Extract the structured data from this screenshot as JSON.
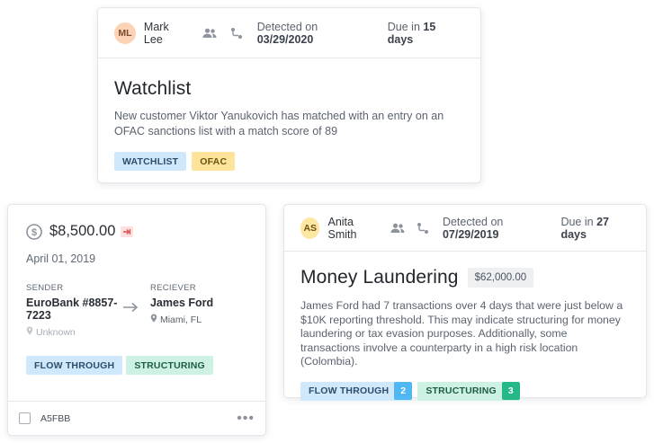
{
  "watchlist_card": {
    "avatar_initials": "ML",
    "owner": "Mark Lee",
    "detected_prefix": "Detected on",
    "detected_date": "03/29/2020",
    "due_prefix": "Due in",
    "due_value": "15 days",
    "title": "Watchlist",
    "description": "New customer Viktor Yanukovich has matched with an entry on an OFAC sanctions list with a match score of 89",
    "tags": [
      "WATCHLIST",
      "OFAC"
    ]
  },
  "transaction_card": {
    "amount": "$8,500.00",
    "date": "April 01, 2019",
    "sender_label": "SENDER",
    "sender_name": "EuroBank #8857-7223",
    "sender_location": "Unknown",
    "receiver_label": "RECIEVER",
    "receiver_name": "James Ford",
    "receiver_location": "Miami, FL",
    "tags": [
      "FLOW THROUGH",
      "STRUCTURING"
    ],
    "id": "A5FBB"
  },
  "laundering_card": {
    "avatar_initials": "AS",
    "owner": "Anita Smith",
    "detected_prefix": "Detected on",
    "detected_date": "07/29/2019",
    "due_prefix": "Due in",
    "due_value": "27 days",
    "title": "Money Laundering",
    "amount": "$62,000.00",
    "description": "James Ford had 7 transactions over 4 days that were just below a $10K reporting threshold. This may indicate structuring for money laundering or tax evasion purposes. Additionally, some transactions involve a counterparty in a high risk location (Colombia).",
    "tags": [
      {
        "label": "FLOW THROUGH",
        "count": "2"
      },
      {
        "label": "STRUCTURING",
        "count": "3"
      }
    ]
  },
  "colors": {
    "tag_blue": "#cfe8fb",
    "tag_yellow": "#fde49a",
    "tag_green": "#cdf2e3",
    "count_blue": "#4fb7f2",
    "count_green": "#27b88a"
  }
}
